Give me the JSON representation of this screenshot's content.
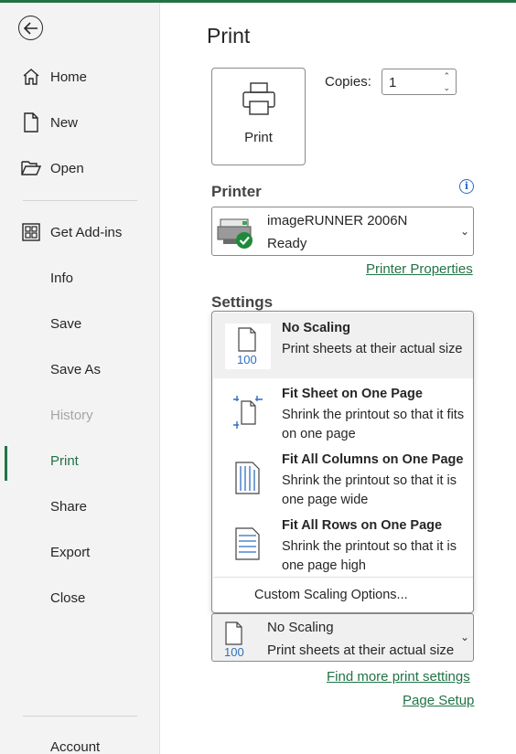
{
  "sidebar": {
    "items": [
      {
        "label": "Home"
      },
      {
        "label": "New"
      },
      {
        "label": "Open"
      },
      {
        "label": "Get Add-ins"
      },
      {
        "label": "Info"
      },
      {
        "label": "Save"
      },
      {
        "label": "Save As"
      },
      {
        "label": "History"
      },
      {
        "label": "Print"
      },
      {
        "label": "Share"
      },
      {
        "label": "Export"
      },
      {
        "label": "Close"
      },
      {
        "label": "Account"
      }
    ],
    "active_item": "Print",
    "disabled_items": [
      "History"
    ]
  },
  "main": {
    "title": "Print",
    "print_button_label": "Print",
    "copies_label": "Copies:",
    "copies_value": "1",
    "printer_heading": "Printer",
    "printer_name": "imageRUNNER 2006N",
    "printer_status": "Ready",
    "printer_properties_link": "Printer Properties",
    "settings_heading": "Settings",
    "scaling_options": [
      {
        "title": "No Scaling",
        "desc": "Print sheets at their actual size",
        "icon": "page-100-icon"
      },
      {
        "title": "Fit Sheet on One Page",
        "desc": "Shrink the printout so that it fits on one page",
        "icon": "fit-sheet-icon"
      },
      {
        "title": "Fit All Columns on One Page",
        "desc": "Shrink the printout so that it is one page wide",
        "icon": "fit-columns-icon"
      },
      {
        "title": "Fit All Rows on One Page",
        "desc": "Shrink the printout so that it is one page high",
        "icon": "fit-rows-icon"
      }
    ],
    "custom_scaling_label": "Custom Scaling Options...",
    "selected_scaling": {
      "title": "No Scaling",
      "desc": "Print sheets at their actual size"
    },
    "icon_badge_text": "100",
    "find_more_link": "Find more print settings",
    "page_setup_link": "Page Setup"
  },
  "colors": {
    "accent": "#217346",
    "info_blue": "#2b6cc4",
    "icon_blue": "#2f6fc0"
  }
}
